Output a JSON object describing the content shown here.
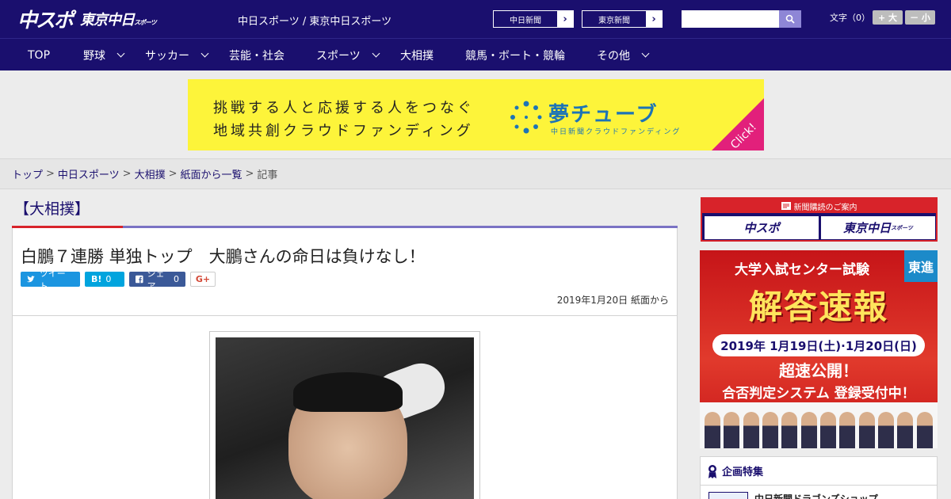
{
  "header": {
    "logo_primary": "中スポ",
    "logo_secondary": "東京中日",
    "logo_secondary_small": "スポーツ",
    "site_name": "中日スポーツ / 東京中日スポーツ",
    "paper_links": [
      {
        "label": "中日新聞"
      },
      {
        "label": "東京新聞"
      }
    ],
    "search": {
      "value": "",
      "placeholder": ""
    },
    "font_size": {
      "label": "文字（0）",
      "increase": "+ 大",
      "decrease": "－ 小"
    }
  },
  "nav": {
    "items": [
      {
        "label": "TOP"
      },
      {
        "label": "野球"
      },
      {
        "label": "サッカー"
      },
      {
        "label": "芸能・社会"
      },
      {
        "label": "スポーツ"
      },
      {
        "label": "大相撲"
      },
      {
        "label": "競馬・ボート・競輪"
      },
      {
        "label": "その他"
      }
    ]
  },
  "banner": {
    "line1": "挑戦する人と応援する人をつなぐ",
    "line2": "地域共創クラウドファンディング",
    "brand": "夢チューブ",
    "brand_sub": "中日新聞クラウドファンディング",
    "click": "Click!",
    "colors": {
      "background": "#fdf43a",
      "brand": "#1d74b6",
      "click": "#e2207b"
    }
  },
  "breadcrumb": {
    "items": [
      "トップ",
      "中日スポーツ",
      "大相撲",
      "紙面から一覧"
    ],
    "current": "記事",
    "separator": ">"
  },
  "article": {
    "category": "【大相撲】",
    "headline": "白鵬７連勝 単独トップ　大鵬さんの命日は負けなし！",
    "share": {
      "tweet": "ツイート",
      "hatena": "B!",
      "hatena_count": "0",
      "facebook": "シェア",
      "facebook_count": "0",
      "google_plus": "G+"
    },
    "date": "2019年1月20日 紙面から"
  },
  "sidebar": {
    "subscription": {
      "title": "新聞購読のご案内",
      "buttons": [
        {
          "label": "中スポ"
        },
        {
          "label": "東京中日",
          "small": "スポーツ"
        }
      ]
    },
    "ad": {
      "corner": "東進",
      "line1": "大学入試センター試験",
      "line2": "解答速報",
      "line3": "2019年 1月19日(土)·1月20日(日)",
      "line4": "超速公開！",
      "line5": "合否判定システム 登録受付中！"
    },
    "feature": {
      "title": "企画特集",
      "item": "中日新聞ドラゴンズショップ"
    }
  },
  "colors": {
    "brand_navy": "#1a0f6e",
    "accent_red": "#d8232a",
    "rule_purple": "#7a72c4"
  }
}
